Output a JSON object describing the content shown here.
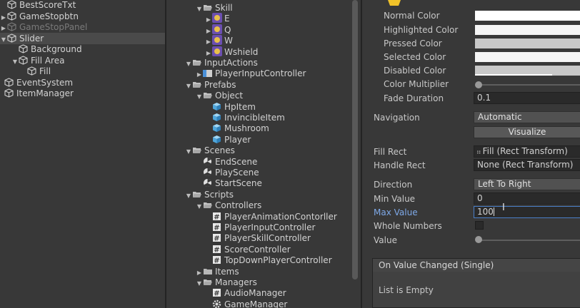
{
  "hierarchy": {
    "items": [
      {
        "label": "BestScoreTxt",
        "indent": 0,
        "arrow": "",
        "dim": false,
        "sel": false
      },
      {
        "label": "GameStopbtn",
        "indent": 0,
        "arrow": "▶",
        "dim": false,
        "sel": false
      },
      {
        "label": "GameStopPanel",
        "indent": 0,
        "arrow": "▶",
        "dim": true,
        "sel": false
      },
      {
        "label": "Slider",
        "indent": 0,
        "arrow": "▼",
        "dim": false,
        "sel": true
      },
      {
        "label": "Background",
        "indent": 1,
        "arrow": "",
        "dim": false,
        "sel": false
      },
      {
        "label": "Fill Area",
        "indent": 1,
        "arrow": "▼",
        "dim": false,
        "sel": false
      },
      {
        "label": "Fill",
        "indent": 2,
        "arrow": "",
        "dim": false,
        "sel": false
      },
      {
        "label": "EventSystem",
        "indent": -1,
        "arrow": "",
        "dim": false,
        "sel": false
      },
      {
        "label": "ItemManager",
        "indent": -1,
        "arrow": "",
        "dim": false,
        "sel": false
      }
    ]
  },
  "project": {
    "items": [
      {
        "label": "Skill",
        "indent": 1,
        "arrow": "▼",
        "icon": "folder-open-icon"
      },
      {
        "label": "E",
        "indent": 2,
        "arrow": "▶",
        "icon": "skill-sprite-icon"
      },
      {
        "label": "Q",
        "indent": 2,
        "arrow": "▶",
        "icon": "skill-sprite-icon"
      },
      {
        "label": "W",
        "indent": 2,
        "arrow": "▶",
        "icon": "skill-sprite-icon"
      },
      {
        "label": "Wshield",
        "indent": 2,
        "arrow": "▶",
        "icon": "skill-sprite-icon"
      },
      {
        "label": "InputActions",
        "indent": 0,
        "arrow": "▼",
        "icon": "folder-open-icon"
      },
      {
        "label": "PlayerInputController",
        "indent": 1,
        "arrow": "▶",
        "icon": "input-actions-icon"
      },
      {
        "label": "Prefabs",
        "indent": 0,
        "arrow": "▼",
        "icon": "folder-open-icon"
      },
      {
        "label": "Object",
        "indent": 1,
        "arrow": "▼",
        "icon": "folder-open-icon"
      },
      {
        "label": "HpItem",
        "indent": 2,
        "arrow": "",
        "icon": "prefab-icon"
      },
      {
        "label": "InvincibleItem",
        "indent": 2,
        "arrow": "",
        "icon": "prefab-icon"
      },
      {
        "label": "Mushroom",
        "indent": 2,
        "arrow": "",
        "icon": "prefab-icon"
      },
      {
        "label": "Player",
        "indent": 2,
        "arrow": "",
        "icon": "prefab-icon"
      },
      {
        "label": "Scenes",
        "indent": 0,
        "arrow": "▼",
        "icon": "folder-open-icon"
      },
      {
        "label": "EndScene",
        "indent": 1,
        "arrow": "",
        "icon": "scene-icon"
      },
      {
        "label": "PlayScene",
        "indent": 1,
        "arrow": "",
        "icon": "scene-icon"
      },
      {
        "label": "StartScene",
        "indent": 1,
        "arrow": "",
        "icon": "scene-icon"
      },
      {
        "label": "Scripts",
        "indent": 0,
        "arrow": "▼",
        "icon": "folder-open-icon"
      },
      {
        "label": "Controllers",
        "indent": 1,
        "arrow": "▼",
        "icon": "folder-open-icon"
      },
      {
        "label": "PlayerAnimationContorller",
        "indent": 2,
        "arrow": "",
        "icon": "script-icon"
      },
      {
        "label": "PlayerInputController",
        "indent": 2,
        "arrow": "",
        "icon": "script-icon"
      },
      {
        "label": "PlayerSkillController",
        "indent": 2,
        "arrow": "",
        "icon": "script-icon"
      },
      {
        "label": "ScoreController",
        "indent": 2,
        "arrow": "",
        "icon": "script-icon"
      },
      {
        "label": "TopDownPlayerController",
        "indent": 2,
        "arrow": "",
        "icon": "script-icon"
      },
      {
        "label": "Items",
        "indent": 1,
        "arrow": "▶",
        "icon": "folder-icon"
      },
      {
        "label": "Managers",
        "indent": 1,
        "arrow": "▼",
        "icon": "folder-open-icon"
      },
      {
        "label": "AudioManager",
        "indent": 2,
        "arrow": "",
        "icon": "script-icon"
      },
      {
        "label": "GameManager",
        "indent": 2,
        "arrow": "",
        "icon": "gear-icon"
      }
    ]
  },
  "inspector": {
    "normal_color_label": "Normal Color",
    "highlighted_color_label": "Highlighted Color",
    "pressed_color_label": "Pressed Color",
    "selected_color_label": "Selected Color",
    "disabled_color_label": "Disabled Color",
    "color_multiplier_label": "Color Multiplier",
    "fade_duration_label": "Fade Duration",
    "fade_duration_value": "0.1",
    "navigation_label": "Navigation",
    "navigation_value": "Automatic",
    "visualize_label": "Visualize",
    "fill_rect_label": "Fill Rect",
    "fill_rect_value": "Fill (Rect Transform)",
    "handle_rect_label": "Handle Rect",
    "handle_rect_value": "None (Rect Transform)",
    "direction_label": "Direction",
    "direction_value": "Left To Right",
    "min_value_label": "Min Value",
    "min_value": "0",
    "max_value_label": "Max Value",
    "max_value": "100",
    "whole_numbers_label": "Whole Numbers",
    "value_label": "Value",
    "event_header": "On Value Changed (Single)",
    "event_empty": "List is Empty",
    "colors": {
      "normal": "#ffffff",
      "highlighted": "#f5f5f5",
      "pressed": "#c8c8c8",
      "selected": "#f5f5f5",
      "disabled": "#c8c8c8",
      "max_value_label": "#7ea9e8"
    },
    "color_multiplier_level": 0.0,
    "value_level": 0.0
  }
}
